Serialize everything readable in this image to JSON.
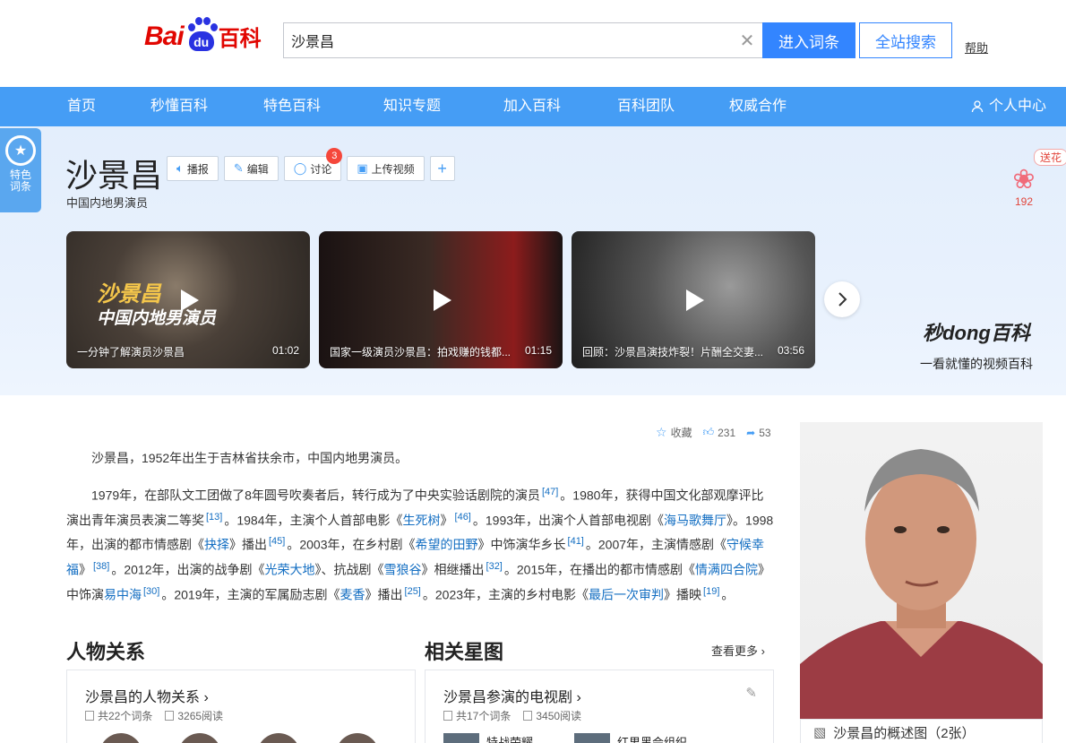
{
  "header": {
    "logo_bai": "Bai",
    "logo_du": "du",
    "logo_baike": "百科",
    "search_value": "沙景昌",
    "enter_label": "进入词条",
    "all_label": "全站搜索",
    "help_label": "帮助"
  },
  "nav": {
    "items": [
      "首页",
      "秒懂百科",
      "特色百科",
      "知识专题",
      "加入百科",
      "百科团队",
      "权威合作"
    ],
    "user_label": "个人中心"
  },
  "hero": {
    "special_badge": "特色\n词条",
    "title": "沙景昌",
    "subtitle": "中国内地男演员",
    "actions": {
      "broadcast": "播报",
      "edit": "编辑",
      "discuss": "讨论",
      "discuss_count": "3",
      "upload": "上传视频"
    },
    "flower": {
      "send": "送花",
      "count": "192"
    },
    "videos": [
      {
        "title": "一分钟了解演员沙景昌",
        "duration": "01:02",
        "overlay1": "沙景昌",
        "overlay2": "中国内地男演员"
      },
      {
        "title": "国家一级演员沙景昌：拍戏赚的钱都...",
        "duration": "01:15"
      },
      {
        "title": "回顾：沙景昌演技炸裂！片酬全交妻...",
        "duration": "03:56"
      }
    ],
    "miaodong": {
      "title": "秒dong百科",
      "slogan": "一看就懂的视频百科"
    }
  },
  "stats": {
    "collect": "收藏",
    "likes": "231",
    "shares": "53"
  },
  "intro": {
    "p1": "沙景昌，1952年出生于吉林省扶余市，中国内地男演员。",
    "p2": {
      "t1": "1979年，在部队文工团做了8年圆号吹奏者后，转行成为了中央实验话剧院的演员",
      "r1": "[47]",
      "t2": "。1980年，获得中国文化部观摩评比演出青年演员表演二等奖",
      "r2": "[13]",
      "t3": "。1984年，主演个人首部电影《",
      "l1": "生死树",
      "t4": "》",
      "r3": "[46]",
      "t5": "。1993年，出演个人首部电视剧《",
      "l2": "海马歌舞厅",
      "t6": "》。1998年，出演的都市情感剧《",
      "l3": "抉择",
      "t7": "》播出",
      "r4": "[45]",
      "t8": "。2003年，在乡村剧《",
      "l4": "希望的田野",
      "t9": "》中饰演华乡长",
      "r5": "[41]",
      "t10": "。2007年，主演情感剧《",
      "l5": "守候幸福",
      "t11": "》",
      "r6": "[38]",
      "t12": "。2012年，出演的战争剧《",
      "l6": "光荣大地",
      "t13": "》、抗战剧《",
      "l7": "雪狼谷",
      "t14": "》相继播出",
      "r7": "[32]",
      "t15": "。2015年，在播出的都市情感剧《",
      "l8": "情满四合院",
      "t16": "》中饰演",
      "l9": "易中海",
      "r8": "[30]",
      "t17": "。2019年，主演的军属励志剧《",
      "l10": "麦香",
      "t18": "》播出",
      "r9": "[25]",
      "t19": "。2023年，主演的乡村电影《",
      "l11": "最后一次审判",
      "t20": "》播映",
      "r10": "[19]",
      "t21": "。"
    }
  },
  "relations": {
    "title": "人物关系",
    "card_title": "沙景昌的人物关系",
    "entries": "共22个词条",
    "reads": "3265阅读"
  },
  "stars": {
    "title": "相关星图",
    "more": "查看更多",
    "card_title": "沙景昌参演的电视剧",
    "entries": "共17个词条",
    "reads": "3450阅读",
    "items": [
      "特战荣耀",
      "红男黑会组织"
    ]
  },
  "portrait": {
    "caption": "沙景昌的概述图（2张）"
  },
  "colors": {
    "brand_blue": "#3385ff",
    "nav_blue": "#459df5",
    "link": "#136ec2",
    "logo_red": "#e10601"
  }
}
